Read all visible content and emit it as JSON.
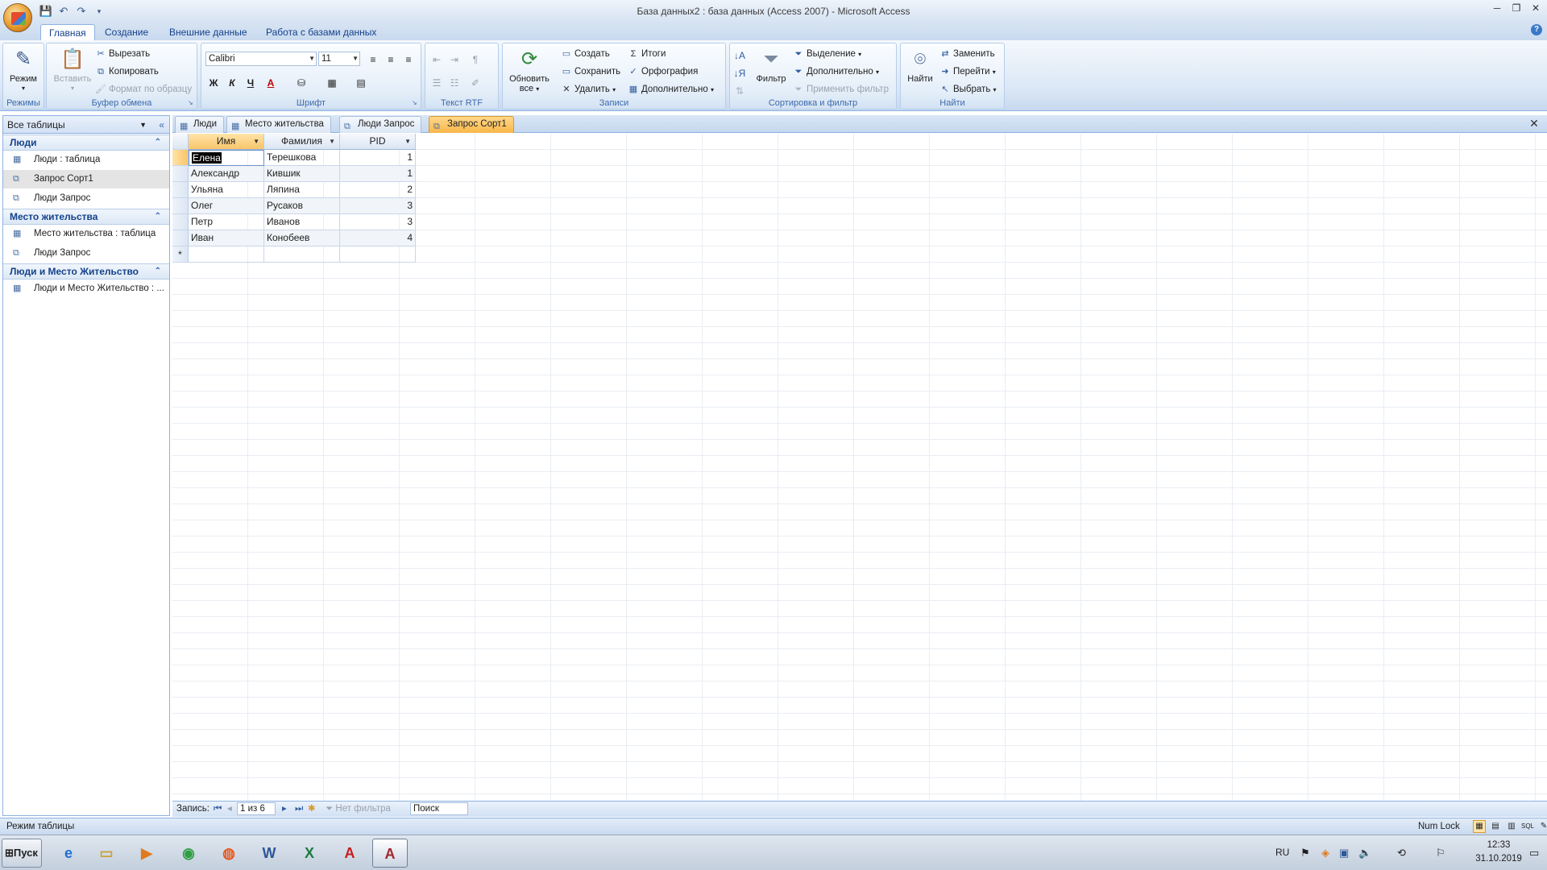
{
  "titlebar": {
    "title": "База данных2 : база данных (Access 2007) - Microsoft Access",
    "controls": [
      "─",
      "❐",
      "✕"
    ]
  },
  "ribbon_tabs": [
    "Главная",
    "Создание",
    "Внешние данные",
    "Работа с базами данных"
  ],
  "ribbon": {
    "modes": {
      "label": "Режимы",
      "mode_button": "Режим"
    },
    "clipboard": {
      "label": "Буфер обмена",
      "paste": "Вставить",
      "cut": "Вырезать",
      "copy": "Копировать",
      "format_painter": "Формат по образцу"
    },
    "font": {
      "label": "Шрифт",
      "font_name": "Calibri",
      "font_size": "11",
      "bold": "Ж",
      "italic": "К",
      "underline": "Ч",
      "font_color": "A"
    },
    "rtf": {
      "label": "Текст RTF"
    },
    "records": {
      "label": "Записи",
      "refresh_line1": "Обновить",
      "refresh_line2": "все",
      "create": "Создать",
      "save": "Сохранить",
      "delete": "Удалить",
      "totals": "Итоги",
      "spelling": "Орфография",
      "more": "Дополнительно"
    },
    "sort": {
      "label": "Сортировка и фильтр",
      "filter": "Фильтр",
      "selection": "Выделение",
      "advanced": "Дополнительно",
      "apply_filter": "Применить фильтр"
    },
    "find": {
      "label": "Найти",
      "find": "Найти",
      "replace": "Заменить",
      "goto": "Перейти",
      "select": "Выбрать"
    }
  },
  "nav": {
    "header": "Все таблицы",
    "groups": [
      {
        "title": "Люди",
        "items": [
          "Люди : таблица",
          "Запрос Сорт1",
          "Люди Запрос"
        ]
      },
      {
        "title": "Место жительства",
        "items": [
          "Место жительства : таблица",
          "Люди Запрос"
        ]
      },
      {
        "title": "Люди и Место Жительство",
        "items": [
          "Люди и Место Жительство : ..."
        ]
      }
    ]
  },
  "doc_tabs": [
    "Люди",
    "Место жительства",
    "Люди Запрос",
    "Запрос Сорт1"
  ],
  "sheet": {
    "columns": [
      "Имя",
      "Фамилия",
      "PID"
    ],
    "rows": [
      [
        "Елена",
        "Терешкова",
        "1"
      ],
      [
        "Александр",
        "Кившик",
        "1"
      ],
      [
        "Ульяна",
        "Ляпина",
        "2"
      ],
      [
        "Олег",
        "Русаков",
        "3"
      ],
      [
        "Петр",
        "Иванов",
        "3"
      ],
      [
        "Иван",
        "Конобеев",
        "4"
      ]
    ],
    "new_row_marker": "*"
  },
  "recnav": {
    "label": "Запись:",
    "position": "1 из 6",
    "no_filter": "Нет фильтра",
    "search": "Поиск"
  },
  "status": {
    "left": "Режим таблицы",
    "numlock": "Num Lock"
  },
  "taskbar": {
    "start": "Пуск",
    "lang": "RU",
    "time": "12:33",
    "date": "31.10.2019"
  },
  "colors": {
    "accent": "#15428b",
    "active_tab": "#f8b74a",
    "ribbon": "#dbe7f5"
  }
}
